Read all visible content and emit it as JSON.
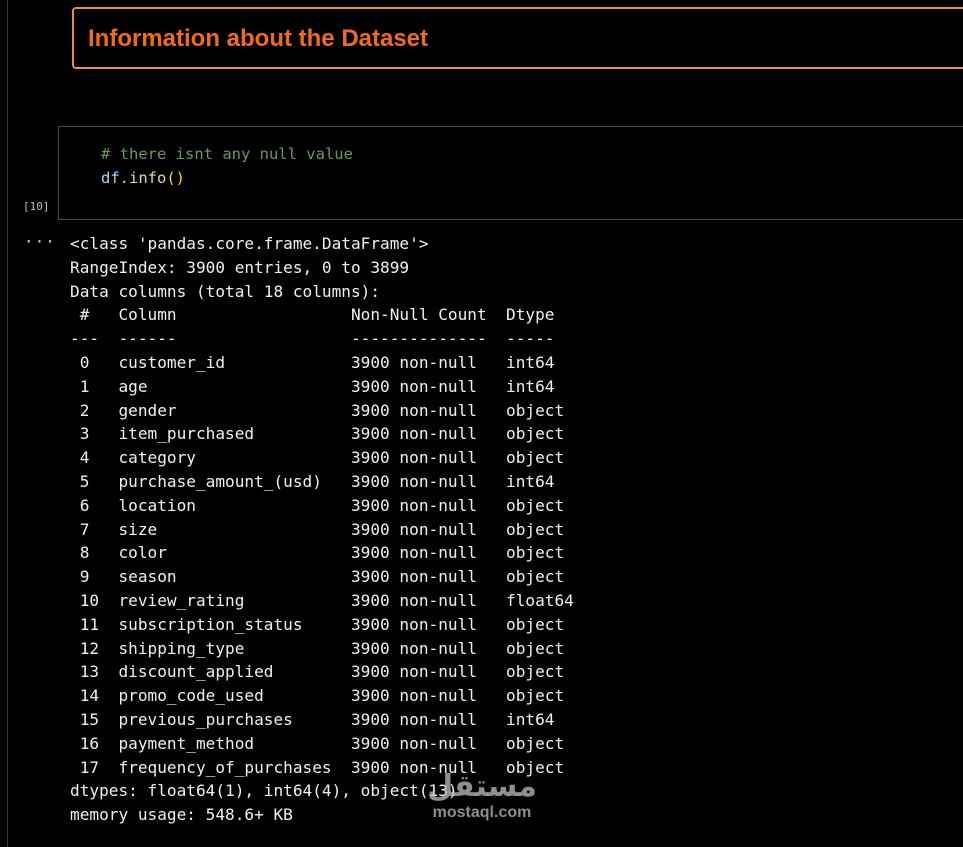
{
  "markdown_cell": {
    "heading": "Information about the Dataset"
  },
  "code_cell": {
    "execution_count": "[10]",
    "comment": "# there isnt any null value",
    "code_var": "df",
    "code_dot": ".",
    "code_func": "info",
    "code_parens": "()"
  },
  "output": {
    "gutter_icon": "ellipsis-icon",
    "gutter_glyph": "···",
    "lines": [
      "<class 'pandas.core.frame.DataFrame'>",
      "RangeIndex: 3900 entries, 0 to 3899",
      "Data columns (total 18 columns):",
      " #   Column                  Non-Null Count  Dtype",
      "---  ------                  --------------  -----",
      " 0   customer_id             3900 non-null   int64",
      " 1   age                     3900 non-null   int64",
      " 2   gender                  3900 non-null   object",
      " 3   item_purchased          3900 non-null   object",
      " 4   category                3900 non-null   object",
      " 5   purchase_amount_(usd)   3900 non-null   int64",
      " 6   location                3900 non-null   object",
      " 7   size                    3900 non-null   object",
      " 8   color                   3900 non-null   object",
      " 9   season                  3900 non-null   object",
      " 10  review_rating           3900 non-null   float64",
      " 11  subscription_status     3900 non-null   object",
      " 12  shipping_type           3900 non-null   object",
      " 13  discount_applied        3900 non-null   object",
      " 14  promo_code_used         3900 non-null   object",
      " 15  previous_purchases      3900 non-null   int64",
      " 16  payment_method          3900 non-null   object",
      " 17  frequency_of_purchases  3900 non-null   object",
      "dtypes: float64(1), int64(4), object(13)",
      "memory usage: 548.6+ KB"
    ]
  },
  "watermark": {
    "logo_text": "مستقل",
    "site_text": "mostaql.com"
  },
  "colors": {
    "heading": "#f26b1d",
    "heading_border": "#f08a3c",
    "comment": "#6a9955",
    "variable": "#9cdcfe",
    "function": "#dcdcaa",
    "paren": "#ffd700"
  }
}
